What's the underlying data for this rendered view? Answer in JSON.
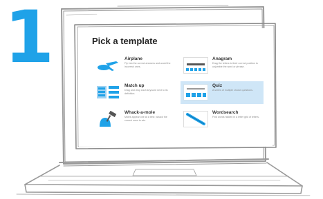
{
  "step": {
    "number": "1"
  },
  "dialog": {
    "title": "Pick a template"
  },
  "templates": [
    {
      "name": "Airplane",
      "desc": "Fly into the correct answers and avoid the incorrect ones.",
      "icon": "airplane-icon",
      "selected": false
    },
    {
      "name": "Anagram",
      "desc": "Drag the letters to their correct position to unjumble the word or phrase.",
      "icon": "anagram-icon",
      "selected": false
    },
    {
      "name": "Match up",
      "desc": "Drag and drop each keyword next to its definition.",
      "icon": "match-up-icon",
      "selected": false
    },
    {
      "name": "Quiz",
      "desc": "A series of multiple choice questions.",
      "icon": "quiz-icon",
      "selected": true
    },
    {
      "name": "Whack-a-mole",
      "desc": "Moles appear one at a time, whack the correct ones to win.",
      "icon": "whack-a-mole-icon",
      "selected": false
    },
    {
      "name": "Wordsearch",
      "desc": "Find words hidden in a letter grid of letters.",
      "icon": "wordsearch-icon",
      "selected": false
    }
  ],
  "colors": {
    "accent": "#1fa2e8",
    "selected": "#cfe6f7"
  }
}
